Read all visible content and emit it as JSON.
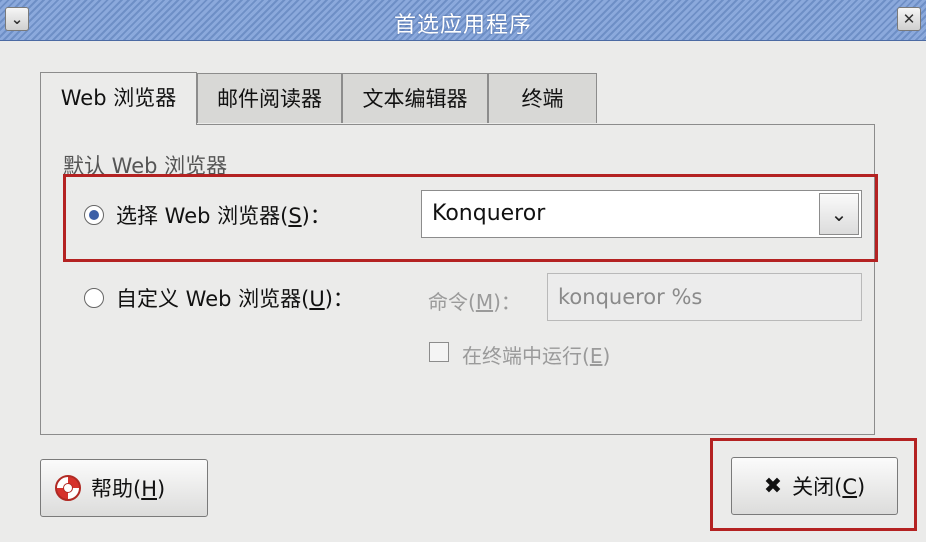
{
  "window": {
    "title": "首选应用程序",
    "menu_icon": "chevron-down-icon",
    "close_icon": "close-icon"
  },
  "tabs": [
    {
      "label": "Web 浏览器",
      "active": true
    },
    {
      "label": "邮件阅读器",
      "active": false
    },
    {
      "label": "文本编辑器",
      "active": false
    },
    {
      "label": "终端",
      "active": false
    }
  ],
  "section": {
    "label": "默认 Web 浏览器"
  },
  "select_option": {
    "label_prefix": "选择 Web 浏览器(",
    "mnemonic": "S",
    "label_suffix": ")：",
    "checked": true,
    "combo_value": "Konqueror"
  },
  "custom_option": {
    "label_prefix": "自定义 Web 浏览器(",
    "mnemonic": "U",
    "label_suffix": ")：",
    "checked": false,
    "command_label_prefix": "命令(",
    "command_mnemonic": "M",
    "command_label_suffix": ")：",
    "command_value": "konqueror %s",
    "terminal_label_prefix": "在终端中运行(",
    "terminal_mnemonic": "E",
    "terminal_label_suffix": ")",
    "terminal_checked": false
  },
  "buttons": {
    "help_prefix": "帮助(",
    "help_mnemonic": "H",
    "help_suffix": ")",
    "close_prefix": "关闭(",
    "close_mnemonic": "C",
    "close_suffix": ")"
  },
  "colors": {
    "highlight": "#b42222",
    "titlebar": "#7d9dd3",
    "radio_selected": "#3c5fa7"
  }
}
